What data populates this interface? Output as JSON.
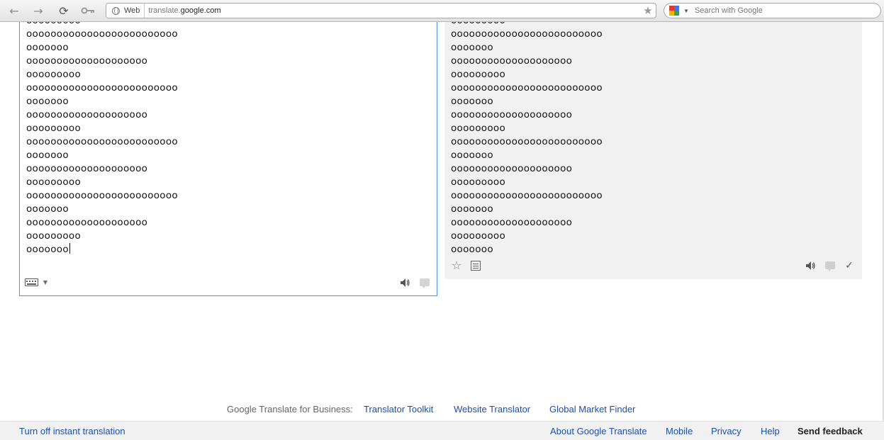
{
  "browser": {
    "back_icon": "back-arrow-icon",
    "forward_icon": "forward-arrow-icon",
    "reload_icon": "reload-icon",
    "key_icon": "key-icon",
    "omnibox": {
      "chip_label": "Web",
      "url_prefix": "translate.",
      "url_host": "google.com"
    },
    "search": {
      "placeholder": "Search with Google"
    }
  },
  "source": {
    "lines": [
      "ooooooooo",
      "ooooooooooooooooooooooooo",
      "ooooooo",
      "oooooooooooooooooooo",
      "ooooooooo",
      "ooooooooooooooooooooooooo",
      "ooooooo",
      "oooooooooooooooooooo",
      "ooooooooo",
      "ooooooooooooooooooooooooo",
      "ooooooo",
      "oooooooooooooooooooo",
      "ooooooooo",
      "ooooooooooooooooooooooooo",
      "ooooooo",
      "oooooooooooooooooooo",
      "ooooooooo",
      "ooooooo"
    ]
  },
  "target": {
    "lines": [
      "ooooooooo",
      "ooooooooooooooooooooooooo",
      "ooooooo",
      "oooooooooooooooooooo",
      "ooooooooo",
      "ooooooooooooooooooooooooo",
      "ooooooo",
      "oooooooooooooooooooo",
      "ooooooooo",
      "ooooooooooooooooooooooooo",
      "ooooooo",
      "oooooooooooooooooooo",
      "ooooooooo",
      "ooooooooooooooooooooooooo",
      "ooooooo",
      "oooooooooooooooooooo",
      "ooooooooo",
      "ooooooo"
    ]
  },
  "business": {
    "label": "Google Translate for Business:",
    "links": [
      "Translator Toolkit",
      "Website Translator",
      "Global Market Finder"
    ]
  },
  "footer": {
    "instant": "Turn off instant translation",
    "links": [
      "About Google Translate",
      "Mobile",
      "Privacy",
      "Help"
    ],
    "send_feedback": "Send feedback"
  },
  "colors": {
    "link": "#1a4fb3",
    "focus_border": "#4d90fe",
    "target_bg": "#f1f1f1"
  }
}
